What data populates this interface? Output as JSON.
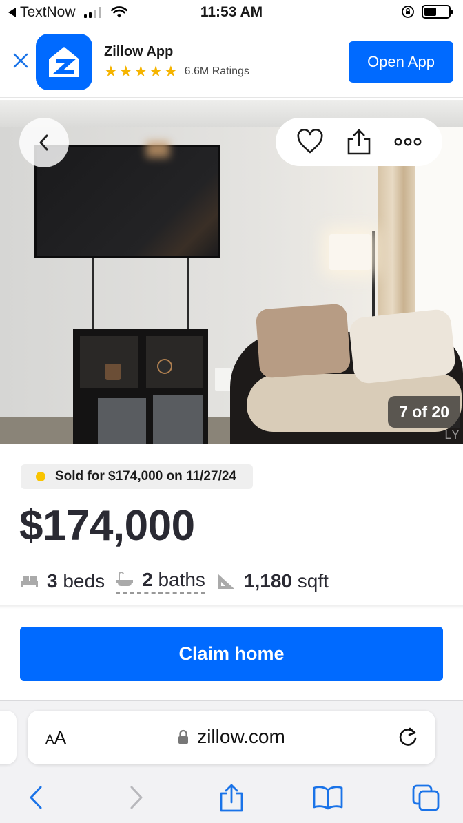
{
  "status_bar": {
    "carrier_back": "TextNow",
    "time": "11:53 AM"
  },
  "app_banner": {
    "app_name": "Zillow App",
    "rating_stars": 5,
    "ratings_text": "6.6M Ratings",
    "open_label": "Open App"
  },
  "photo": {
    "counter": "7 of 20",
    "watermark": "LY"
  },
  "listing": {
    "sold_text": "Sold for $174,000 on 11/27/24",
    "price": "$174,000",
    "beds_num": "3",
    "beds_label": "beds",
    "baths_num": "2",
    "baths_label": "baths",
    "sqft_num": "1,180",
    "sqft_label": "sqft"
  },
  "cta": {
    "claim_label": "Claim home"
  },
  "browser": {
    "aa_small": "A",
    "aa_large": "A",
    "url": "zillow.com"
  },
  "colors": {
    "brand_blue": "#006aff",
    "sold_dot": "#f9c400",
    "star": "#f5b400",
    "safari_blue": "#1a73e8"
  }
}
